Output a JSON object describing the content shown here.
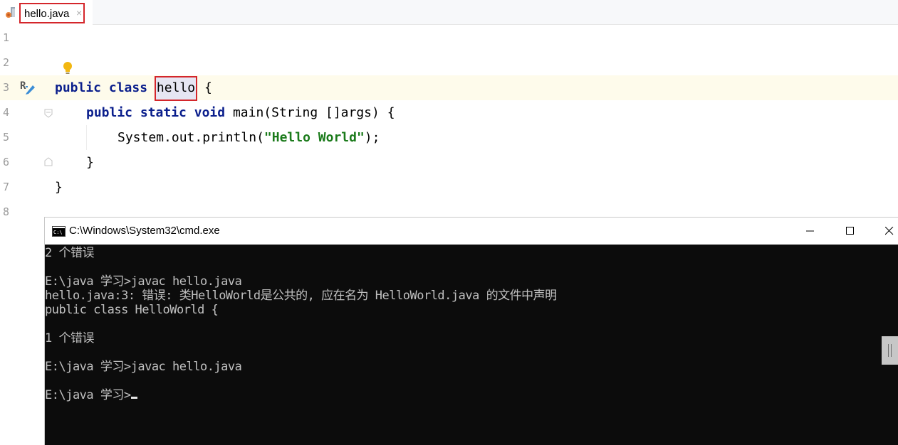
{
  "editor": {
    "tab": {
      "label": "hello.java",
      "close": "×"
    },
    "line_numbers": [
      "1",
      "2",
      "3",
      "4",
      "5",
      "6",
      "7",
      "8"
    ],
    "code": {
      "line3": {
        "kw1": "public",
        "kw2": "class",
        "ident": "hello",
        "brace": "{"
      },
      "line4": {
        "kw1": "public",
        "kw2": "static",
        "kw3": "void",
        "rest": "main(String []args) {"
      },
      "line5": {
        "pre": "System.out.println(",
        "str": "\"Hello World\"",
        "post": ");"
      },
      "line6": {
        "text": "}"
      },
      "line7": {
        "text": "}"
      }
    }
  },
  "cmd": {
    "title": "C:\\Windows\\System32\\cmd.exe",
    "lines": [
      "2 个错误",
      "",
      "E:\\java 学习>javac hello.java",
      "hello.java:3: 错误: 类HelloWorld是公共的, 应在名为 HelloWorld.java 的文件中声明",
      "public class HelloWorld {",
      "",
      "1 个错误",
      "",
      "E:\\java 学习>javac hello.java",
      "",
      "E:\\java 学习>"
    ]
  },
  "colors": {
    "keyword": "#0a1e8c",
    "string": "#1a7a1a",
    "highlight_box": "#d4262b",
    "console_bg": "#0c0c0c",
    "console_text": "#c0c0c0"
  },
  "icons": [
    "java-file-icon",
    "lightbulb-icon",
    "implemented-icon",
    "fold-icon",
    "cmd-icon",
    "minimize-icon",
    "maximize-icon",
    "close-icon"
  ]
}
